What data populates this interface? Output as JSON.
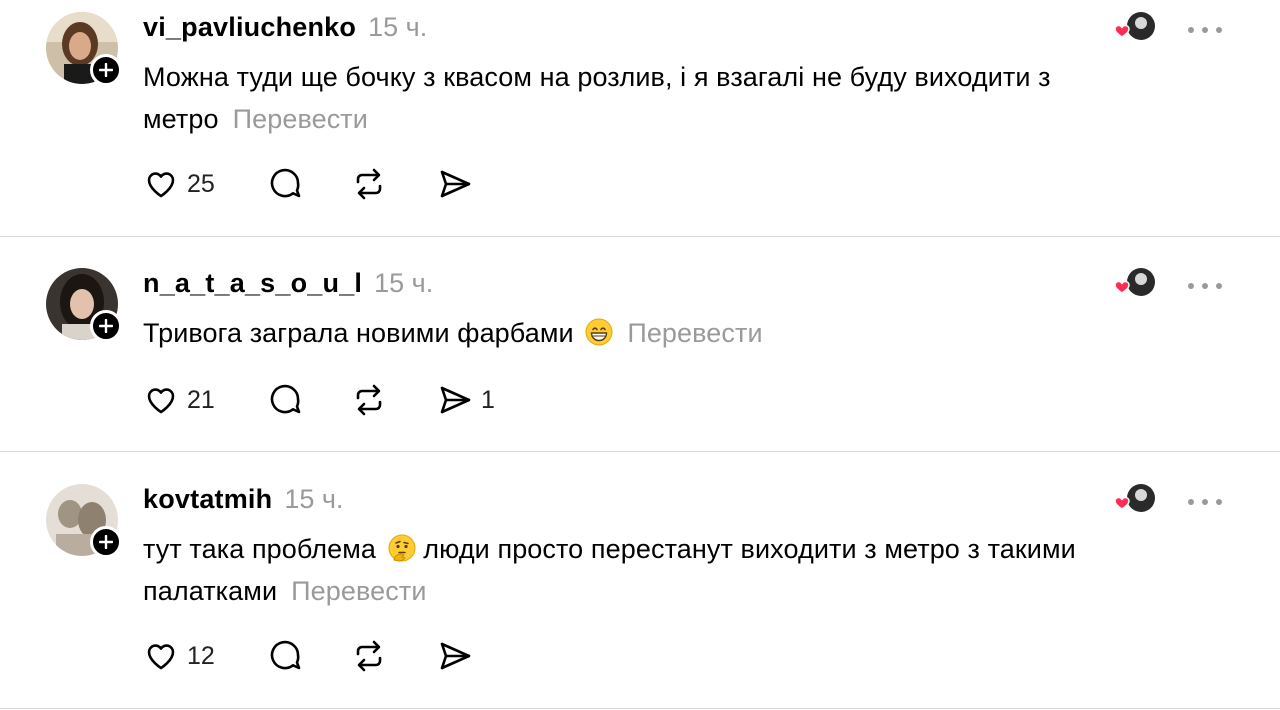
{
  "translate_label": "Перевести",
  "posts": [
    {
      "username": "vi_pavliuchenko",
      "time": "15 ч.",
      "text_line1": "Можна туди ще бочку з квасом на розлив, і я взагалі не буду виходити з",
      "text_line2": "метро",
      "likes": "25",
      "shares": ""
    },
    {
      "username": "n_a_t_a_s_o_u_l",
      "time": "15 ч.",
      "text_line1": "Тривога заграла новими фарбами",
      "text_line2": "",
      "emoji": "grinning-face",
      "likes": "21",
      "shares": "1"
    },
    {
      "username": "kovtatmih",
      "time": "15 ч.",
      "text_line1a": "тут така проблема",
      "text_line1b": "люди просто перестанут виходити з метро з такими",
      "text_line2": "палатками",
      "emoji": "thinking-face",
      "likes": "12",
      "shares": ""
    }
  ],
  "colors": {
    "muted": "#9a9a9a",
    "heart": "#ff2d55",
    "divider": "#dcdcdc"
  }
}
